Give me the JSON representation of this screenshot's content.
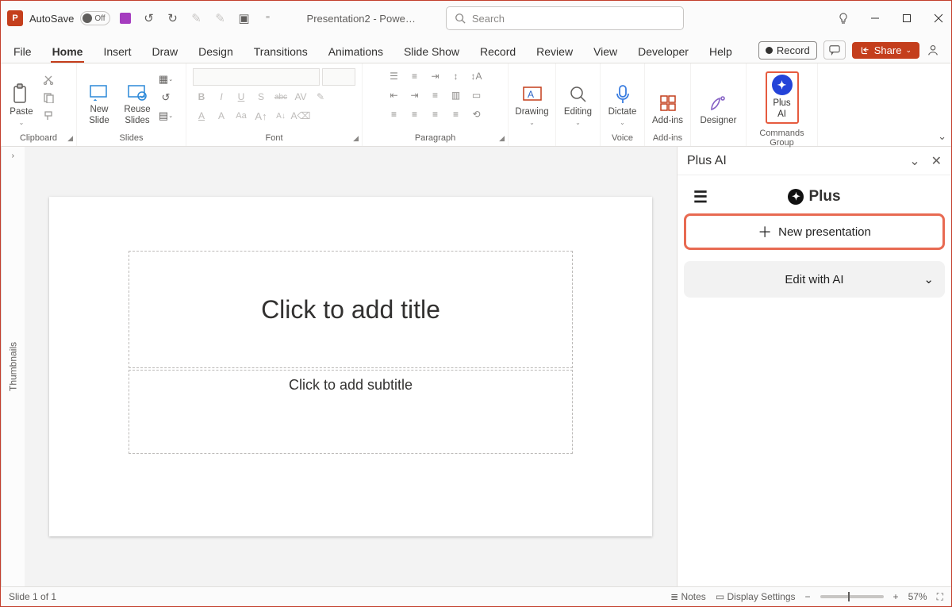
{
  "titlebar": {
    "autosave_label": "AutoSave",
    "autosave_state": "Off",
    "doc_title": "Presentation2  -  Powe…",
    "search_placeholder": "Search"
  },
  "tabs": {
    "items": [
      {
        "label": "File"
      },
      {
        "label": "Home"
      },
      {
        "label": "Insert"
      },
      {
        "label": "Draw"
      },
      {
        "label": "Design"
      },
      {
        "label": "Transitions"
      },
      {
        "label": "Animations"
      },
      {
        "label": "Slide Show"
      },
      {
        "label": "Record"
      },
      {
        "label": "Review"
      },
      {
        "label": "View"
      },
      {
        "label": "Developer"
      },
      {
        "label": "Help"
      }
    ],
    "active_index": 1,
    "record_label": "Record",
    "share_label": "Share"
  },
  "ribbon": {
    "clipboard": {
      "paste": "Paste",
      "label": "Clipboard"
    },
    "slides": {
      "new_slide": "New\nSlide",
      "reuse": "Reuse\nSlides",
      "label": "Slides"
    },
    "font": {
      "label": "Font",
      "bold": "B",
      "italic": "I",
      "underline": "U",
      "shadow": "S",
      "strike": "abc",
      "spacing": "AV"
    },
    "paragraph": {
      "label": "Paragraph"
    },
    "drawing_label": "Drawing",
    "editing_label": "Editing",
    "dictate_label": "Dictate",
    "voice_label": "Voice",
    "addins_label": "Add-ins",
    "addins_group": "Add-ins",
    "designer_label": "Designer",
    "plusai_label": "Plus\nAI",
    "commands_group": "Commands Group"
  },
  "thumbnails_label": "Thumbnails",
  "slide": {
    "title_placeholder": "Click to add title",
    "subtitle_placeholder": "Click to add subtitle"
  },
  "sidepane": {
    "title": "Plus AI",
    "brand": "Plus",
    "new_presentation": "New presentation",
    "edit_with_ai": "Edit with AI"
  },
  "statusbar": {
    "slide_info": "Slide 1 of 1",
    "notes": "Notes",
    "display_settings": "Display Settings",
    "zoom": "57%"
  }
}
